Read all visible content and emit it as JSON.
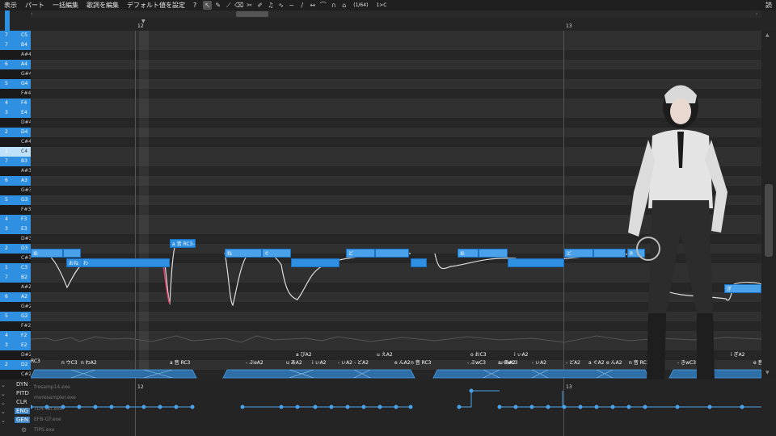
{
  "menu": {
    "items": [
      "表示",
      "パート",
      "一括編集",
      "歌詞を編集",
      "デフォルト値を設定",
      "?"
    ],
    "status": "(1/64)",
    "shortcut": "1>C",
    "corner": "読"
  },
  "tools": [
    "cursor-icon",
    "pencil-icon",
    "line-pencil-icon",
    "eraser-icon",
    "knife-icon",
    "brush-icon",
    "note-icon",
    "vibrato-icon",
    "tilde-icon",
    "slash-icon",
    "arrow-icon",
    "tie-icon",
    "curve-icon",
    "snap-icon"
  ],
  "ruler": {
    "bars": [
      "12",
      "13"
    ]
  },
  "piano_keys": [
    {
      "oct": "7",
      "name": "C5",
      "t": "blue"
    },
    {
      "oct": "7",
      "name": "B4",
      "t": "blue"
    },
    {
      "oct": "",
      "name": "A#4",
      "t": "dark"
    },
    {
      "oct": "6",
      "name": "A4",
      "t": "blue"
    },
    {
      "oct": "",
      "name": "G#4",
      "t": "dark"
    },
    {
      "oct": "5",
      "name": "G4",
      "t": "blue"
    },
    {
      "oct": "",
      "name": "F#4",
      "t": "dark"
    },
    {
      "oct": "4",
      "name": "F4",
      "t": "blue"
    },
    {
      "oct": "3",
      "name": "E4",
      "t": "blue"
    },
    {
      "oct": "",
      "name": "D#4",
      "t": "dark"
    },
    {
      "oct": "2",
      "name": "D4",
      "t": "blue"
    },
    {
      "oct": "",
      "name": "C#4",
      "t": "dark"
    },
    {
      "oct": "1",
      "name": "C4",
      "t": "light"
    },
    {
      "oct": "7",
      "name": "B3",
      "t": "blue"
    },
    {
      "oct": "",
      "name": "A#3",
      "t": "dark"
    },
    {
      "oct": "6",
      "name": "A3",
      "t": "blue"
    },
    {
      "oct": "",
      "name": "G#3",
      "t": "dark"
    },
    {
      "oct": "5",
      "name": "G3",
      "t": "blue"
    },
    {
      "oct": "",
      "name": "F#3",
      "t": "dark"
    },
    {
      "oct": "4",
      "name": "F3",
      "t": "blue"
    },
    {
      "oct": "3",
      "name": "E3",
      "t": "blue"
    },
    {
      "oct": "",
      "name": "D#3",
      "t": "dark"
    },
    {
      "oct": "2",
      "name": "D3",
      "t": "blue"
    },
    {
      "oct": "",
      "name": "C#3",
      "t": "dark"
    },
    {
      "oct": "1",
      "name": "C3",
      "t": "blue"
    },
    {
      "oct": "7",
      "name": "B2",
      "t": "blue"
    },
    {
      "oct": "",
      "name": "A#2",
      "t": "dark"
    },
    {
      "oct": "6",
      "name": "A2",
      "t": "blue"
    },
    {
      "oct": "",
      "name": "G#2",
      "t": "dark"
    },
    {
      "oct": "5",
      "name": "G2",
      "t": "blue"
    },
    {
      "oct": "",
      "name": "F#2",
      "t": "dark"
    },
    {
      "oct": "4",
      "name": "F2",
      "t": "blue"
    },
    {
      "oct": "3",
      "name": "E2",
      "t": "blue"
    },
    {
      "oct": "",
      "name": "D#2",
      "t": "dark"
    },
    {
      "oct": "2",
      "name": "D2",
      "t": "blue"
    },
    {
      "oct": "",
      "name": "C#2",
      "t": "dark"
    },
    {
      "oct": "1",
      "name": "C2",
      "t": "blue"
    }
  ],
  "notes": [
    {
      "label": "お",
      "sel": true
    },
    {
      "label": "",
      "sel": true
    },
    {
      "label": "わ",
      "sel": false
    },
    {
      "label": "おね",
      "sel": false
    },
    {
      "label": "a 音 RC3→",
      "sel": false
    },
    {
      "label": "ね",
      "sel": true
    },
    {
      "label": "ぐ",
      "sel": true
    },
    {
      "label": "",
      "sel": false
    },
    {
      "label": "ど",
      "sel": true
    },
    {
      "label": "",
      "sel": true
    },
    {
      "label": "",
      "sel": false
    },
    {
      "label": "お",
      "sel": true
    },
    {
      "label": "",
      "sel": true
    },
    {
      "label": "",
      "sel": false
    },
    {
      "label": "ど",
      "sel": true
    },
    {
      "label": "",
      "sel": true
    },
    {
      "label": "R",
      "sel": true
    },
    {
      "label": "ぎ",
      "sel": true
    }
  ],
  "phonemes": [
    "RC3",
    "n ウC3",
    "n わA2",
    "a 音 RC3",
    "- ぶeA2",
    "a びA2",
    "u あA2",
    "i ぃA2",
    "- ぃA2",
    "- どA2",
    "u えA2",
    "e んA2",
    "n 音 RC3",
    "o おC3",
    "- ぶwC3",
    "a ぐwC3",
    "u あA2",
    "i ぃA2",
    "- ぃA2",
    "- どA2",
    "a ぐA2",
    "e んA2",
    "n 音 RC3",
    "- きwC3",
    "i ぎA2",
    "e 音"
  ],
  "params": [
    "DYN",
    "PITD",
    "CLR",
    "ENG",
    "GEN"
  ],
  "plugins": [
    "fresamp14.exe",
    "moresampler.exe",
    "TD4-ret.exe",
    "EFB-GT.exe",
    "TIPS.exe"
  ]
}
